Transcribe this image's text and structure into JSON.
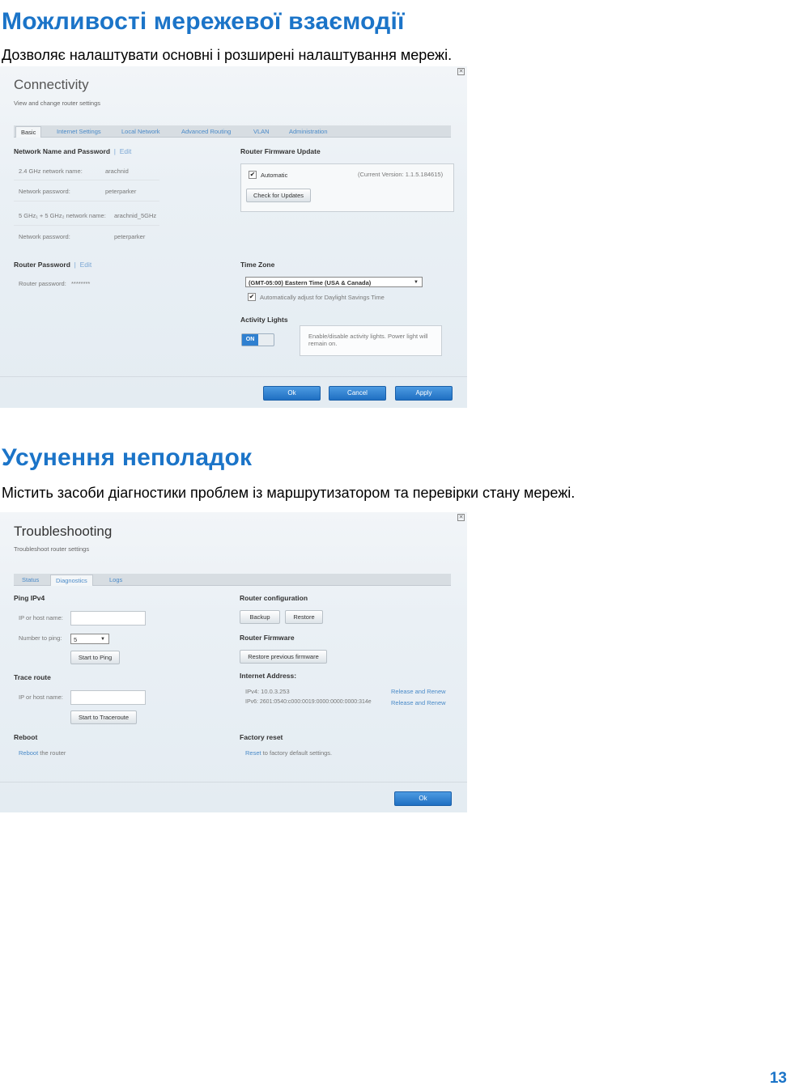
{
  "section1": {
    "heading": "Можливості мережевої взаємодії",
    "description": "Дозволяє налаштувати основні і розширені налаштування мережі."
  },
  "connectivity": {
    "title": "Connectivity",
    "subtitle": "View and change router settings",
    "tabs": [
      "Basic",
      "Internet Settings",
      "Local Network",
      "Advanced Routing",
      "VLAN",
      "Administration"
    ],
    "network": {
      "heading": "Network Name and Password",
      "edit": "Edit",
      "ssid24_label": "2.4 GHz network name:",
      "ssid24_value": "arachnid",
      "pw24_label": "Network password:",
      "pw24_value": "peterparker",
      "ssid5_label": "5 GHz₁ + 5 GHz₂ network name:",
      "ssid5_value": "arachnid_5GHz",
      "pw5_label": "Network password:",
      "pw5_value": "peterparker"
    },
    "router_password": {
      "heading": "Router Password",
      "edit": "Edit",
      "label": "Router password:",
      "value": "********"
    },
    "firmware": {
      "heading": "Router Firmware Update",
      "automatic": "Automatic",
      "version": "(Current Version: 1.1.5.184615)",
      "check_button": "Check for Updates"
    },
    "timezone": {
      "heading": "Time Zone",
      "selected": "(GMT-05:00) Eastern Time (USA & Canada)",
      "dst": "Automatically adjust for Daylight Savings Time"
    },
    "activity": {
      "heading": "Activity Lights",
      "toggle": "ON",
      "info": "Enable/disable activity lights. Power light will remain on."
    },
    "buttons": {
      "ok": "Ok",
      "cancel": "Cancel",
      "apply": "Apply"
    }
  },
  "section2": {
    "heading": "Усунення неполадок",
    "description": "Містить засоби діагностики проблем із маршрутизатором та перевірки стану мережі."
  },
  "troubleshooting": {
    "title": "Troubleshooting",
    "subtitle": "Troubleshoot router settings",
    "tabs": [
      "Status",
      "Diagnostics",
      "Logs"
    ],
    "ping": {
      "heading": "Ping IPv4",
      "host_label": "IP or host name:",
      "count_label": "Number to ping:",
      "count_value": "5",
      "button": "Start to Ping"
    },
    "trace": {
      "heading": "Trace route",
      "host_label": "IP or host name:",
      "button": "Start to Traceroute"
    },
    "reboot": {
      "heading": "Reboot",
      "link": "Reboot",
      "text": " the router"
    },
    "router_config": {
      "heading": "Router configuration",
      "backup": "Backup",
      "restore": "Restore"
    },
    "router_firmware": {
      "heading": "Router Firmware",
      "button": "Restore previous firmware"
    },
    "internet": {
      "heading": "Internet Address:",
      "ipv4": "IPv4: 10.0.3.253",
      "ipv6": "IPv6: 2601:0540:c000:0019:0000:0000:0000:314e",
      "renew1": "Release and Renew",
      "renew2": "Release and Renew"
    },
    "factory": {
      "heading": "Factory reset",
      "link": "Reset",
      "text": " to factory default settings."
    },
    "buttons": {
      "ok": "Ok"
    }
  },
  "page_number": "13"
}
